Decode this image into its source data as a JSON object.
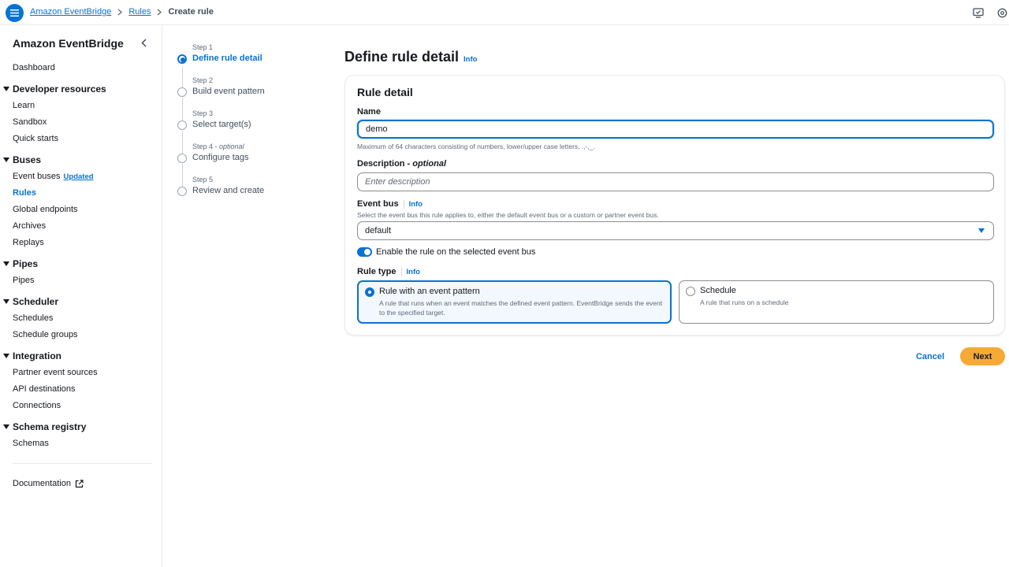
{
  "topbar": {
    "breadcrumbs": [
      "Amazon EventBridge",
      "Rules",
      "Create rule"
    ],
    "icons": [
      "menu-icon",
      "chevron-right-icon",
      "feedback-icon",
      "settings-icon"
    ]
  },
  "sidebar": {
    "title": "Amazon EventBridge",
    "dashboard": "Dashboard",
    "sections": [
      {
        "title": "Developer resources",
        "items": [
          "Learn",
          "Sandbox",
          "Quick starts"
        ]
      },
      {
        "title": "Buses",
        "items": [
          "Event buses",
          "Rules",
          "Global endpoints",
          "Archives",
          "Replays"
        ]
      },
      {
        "title": "Pipes",
        "items": [
          "Pipes"
        ]
      },
      {
        "title": "Scheduler",
        "items": [
          "Schedules",
          "Schedule groups"
        ]
      },
      {
        "title": "Integration",
        "items": [
          "Partner event sources",
          "API destinations",
          "Connections"
        ]
      },
      {
        "title": "Schema registry",
        "items": [
          "Schemas"
        ]
      }
    ],
    "event_buses_badge": "Updated",
    "active_item": "Rules",
    "documentation": "Documentation"
  },
  "steps": [
    {
      "label": "Step 1",
      "title": "Define rule detail"
    },
    {
      "label": "Step 2",
      "title": "Build event pattern"
    },
    {
      "label": "Step 3",
      "title": "Select target(s)"
    },
    {
      "label": "Step 4",
      "optional": "optional",
      "title": "Configure tags"
    },
    {
      "label": "Step 5",
      "title": "Review and create"
    }
  ],
  "main": {
    "title": "Define rule detail",
    "info": "Info",
    "panel_title": "Rule detail",
    "name_label": "Name",
    "name_value": "demo",
    "name_hint": "Maximum of 64 characters consisting of numbers, lower/upper case letters, .,-,_.",
    "description_label": "Description",
    "description_optional": "- optional",
    "description_placeholder": "Enter description",
    "event_bus_label": "Event bus",
    "event_bus_hint": "Select the event bus this rule applies to, either the default event bus or a custom or partner event bus.",
    "event_bus_value": "default",
    "toggle_label": "Enable the rule on the selected event bus",
    "toggle_on": true,
    "rule_type_label": "Rule type",
    "rule_types": [
      {
        "title": "Rule with an event pattern",
        "desc": "A rule that runs when an event matches the defined event pattern. EventBridge sends the event to the specified target.",
        "selected": true
      },
      {
        "title": "Schedule",
        "desc": "A rule that runs on a schedule",
        "selected": false
      }
    ],
    "cancel": "Cancel",
    "next": "Next"
  },
  "colors": {
    "accent": "#0972d3",
    "primary_button": "#f6a935"
  }
}
